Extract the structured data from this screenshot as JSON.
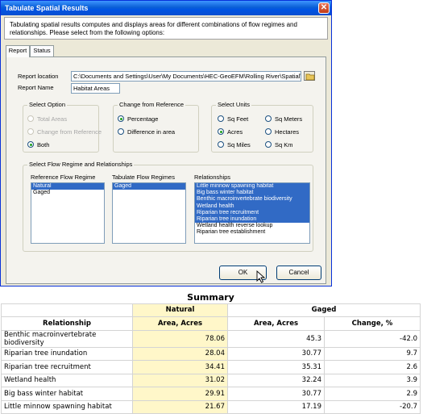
{
  "dialog": {
    "title": "Tabulate Spatial Results",
    "close_glyph": "✕",
    "intro": "Tabulating spatial results computes and displays areas for different combinations of flow regimes and relationships.  Please select from the following options:",
    "tabs": [
      "Report",
      "Status"
    ],
    "report_location_label": "Report location",
    "report_location_value": "C:\\Documents and Settings\\User\\My Documents\\HEC-GeoEFM\\Rolling River\\Spatial\\",
    "report_name_label": "Report Name",
    "report_name_value": "Habitat Areas",
    "select_option": {
      "title": "Select Option",
      "options": [
        "Total Areas",
        "Change from Reference",
        "Both"
      ],
      "selected": "Both"
    },
    "change_from_reference": {
      "title": "Change from Reference",
      "options": [
        "Percentage",
        "Difference in area"
      ],
      "selected": "Percentage"
    },
    "select_units": {
      "title": "Select Units",
      "options": [
        "Sq Feet",
        "Sq Meters",
        "Acres",
        "Hectares",
        "Sq Miles",
        "Sq Km"
      ],
      "selected": "Acres"
    },
    "flow_regime_group": {
      "title": "Select Flow Regime and Relationships",
      "reference_label": "Reference Flow Regime",
      "reference_items": [
        "Natural",
        "Gaged"
      ],
      "tabulate_label": "Tabulate Flow Regimes",
      "tabulate_items": [
        "Gaged"
      ],
      "relationships_label": "Relationships",
      "relationship_items": [
        "Little minnow spawning habitat",
        "Big bass winter habitat",
        "Benthic macroinvertebrate biodiversity",
        "Wetland health",
        "Riparian tree recruitment",
        "Riparian tree inundation",
        "Wetland health reverse lookup",
        "Riparian tree establishment"
      ]
    },
    "ok_label": "OK",
    "cancel_label": "Cancel"
  },
  "summary": {
    "title": "Summary",
    "group_natural": "Natural",
    "group_gaged": "Gaged",
    "columns": [
      "Relationship",
      "Area, Acres",
      "Area, Acres",
      "Change, %"
    ],
    "rows": [
      [
        "Benthic macroinvertebrate biodiversity",
        "78.06",
        "45.3",
        "-42.0"
      ],
      [
        "Riparian tree inundation",
        "28.04",
        "30.77",
        "9.7"
      ],
      [
        "Riparian tree recruitment",
        "34.41",
        "35.31",
        "2.6"
      ],
      [
        "Wetland health",
        "31.02",
        "32.24",
        "3.9"
      ],
      [
        "Big bass winter habitat",
        "29.91",
        "30.77",
        "2.9"
      ],
      [
        "Little minnow spawning habitat",
        "21.67",
        "17.19",
        "-20.7"
      ]
    ]
  }
}
